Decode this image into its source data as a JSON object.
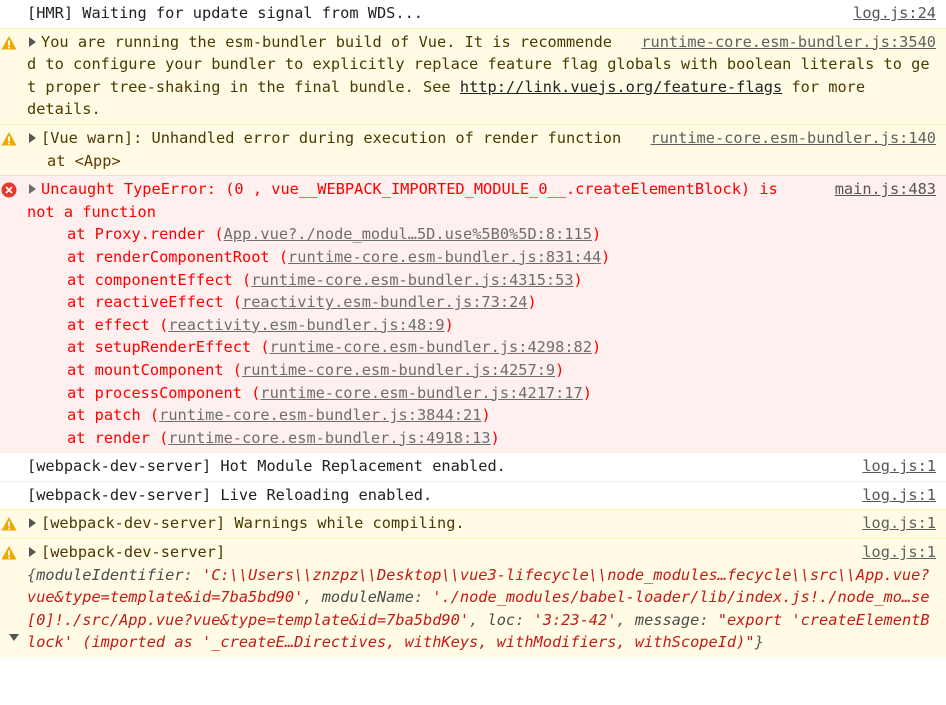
{
  "messages": {
    "m1": {
      "text": "[HMR] Waiting for update signal from WDS...",
      "source": "log.js:24"
    },
    "m2": {
      "text": "You are running the esm-bundler build of Vue. It is recommended to configure your bundler to explicitly replace feature flag globals with boolean literals to get proper tree-shaking in the final bundle. See ",
      "link": "http://link.vuejs.org/feature-flags",
      "text_after": " for more details.",
      "source": "runtime-core.esm-bundler.js:3540"
    },
    "m3": {
      "text": "[Vue warn]: Unhandled error during execution of render function",
      "detail": "at <App>",
      "source": "runtime-core.esm-bundler.js:140"
    },
    "m4": {
      "text": "Uncaught TypeError: (0 , vue__WEBPACK_IMPORTED_MODULE_0__.createElementBlock) is not a function",
      "source": "main.js:483",
      "stack": [
        {
          "fn": "at Proxy.render (",
          "loc": "App.vue?./node_modul…5D.use%5B0%5D:8:115",
          "end": ")"
        },
        {
          "fn": "at renderComponentRoot (",
          "loc": "runtime-core.esm-bundler.js:831:44",
          "end": ")"
        },
        {
          "fn": "at componentEffect (",
          "loc": "runtime-core.esm-bundler.js:4315:53",
          "end": ")"
        },
        {
          "fn": "at reactiveEffect (",
          "loc": "reactivity.esm-bundler.js:73:24",
          "end": ")"
        },
        {
          "fn": "at effect (",
          "loc": "reactivity.esm-bundler.js:48:9",
          "end": ")"
        },
        {
          "fn": "at setupRenderEffect (",
          "loc": "runtime-core.esm-bundler.js:4298:82",
          "end": ")"
        },
        {
          "fn": "at mountComponent (",
          "loc": "runtime-core.esm-bundler.js:4257:9",
          "end": ")"
        },
        {
          "fn": "at processComponent (",
          "loc": "runtime-core.esm-bundler.js:4217:17",
          "end": ")"
        },
        {
          "fn": "at patch (",
          "loc": "runtime-core.esm-bundler.js:3844:21",
          "end": ")"
        },
        {
          "fn": "at render (",
          "loc": "runtime-core.esm-bundler.js:4918:13",
          "end": ")"
        }
      ]
    },
    "m5": {
      "text": "[webpack-dev-server] Hot Module Replacement enabled.",
      "source": "log.js:1"
    },
    "m6": {
      "text": "[webpack-dev-server] Live Reloading enabled.",
      "source": "log.js:1"
    },
    "m7": {
      "text": "[webpack-dev-server] Warnings while compiling.",
      "source": "log.js:1"
    },
    "m8": {
      "text": "[webpack-dev-server]",
      "source": "log.js:1",
      "object": {
        "open": "{",
        "k1": "moduleIdentifier",
        "v1": "'C:\\\\Users\\\\znzpz\\\\Desktop\\\\vue3-lifecycle\\\\node_modules…fecycle\\\\src\\\\App.vue?vue&type=template&id=7ba5bd90'",
        "k2": "moduleName",
        "v2": "'./node_modules/babel-loader/lib/index.js!./node_mo…se[0]!./src/App.vue?vue&type=template&id=7ba5bd90'",
        "k3": "loc",
        "v3": "'3:23-42'",
        "k4": "message",
        "v4": "\"export 'createElementBlock' (imported as '_createE…Directives, withKeys, withModifiers, withScopeId)\"",
        "close": "}"
      }
    }
  },
  "colors": {
    "warn_bg": "#fffbe5",
    "error_bg": "#fff0f0",
    "error_text": "#fe0000",
    "warn_icon": "#f2a600",
    "error_icon": "#e8362b"
  }
}
